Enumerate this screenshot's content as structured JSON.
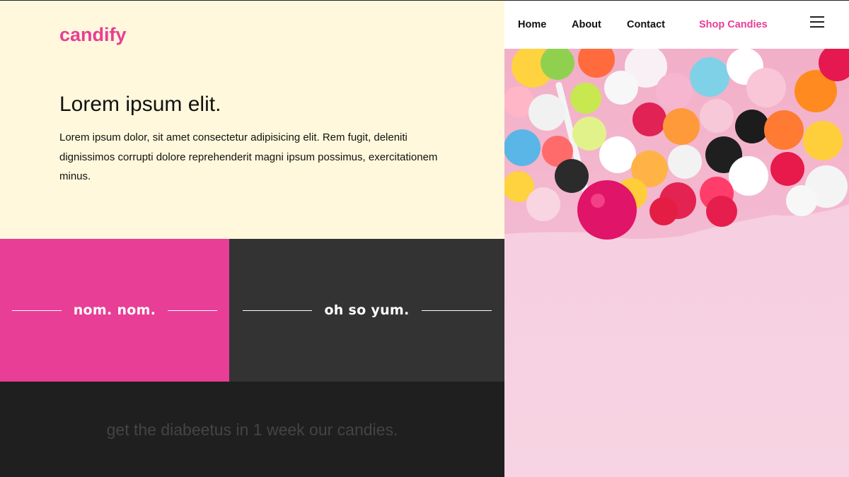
{
  "brand": {
    "name": "candify",
    "accent": "#e83e96"
  },
  "hero": {
    "headline": "Lorem ipsum elit.",
    "body": "Lorem ipsum dolor, sit amet consectetur adipisicing elit. Rem fugit, deleniti dignissimos corrupti dolore reprehenderit magni ipsum possimus, exercitationem minus."
  },
  "tiles": [
    {
      "label": "nom. nom.",
      "color": "#e83e96"
    },
    {
      "label": "oh so yum.",
      "color": "#333333"
    }
  ],
  "tagline": "get the diabeetus in 1 week our candies.",
  "nav": {
    "items": [
      {
        "label": "Home"
      },
      {
        "label": "About"
      },
      {
        "label": "Contact"
      },
      {
        "label": "Shop Candies"
      }
    ],
    "menu_icon": "hamburger-menu-icon"
  },
  "image": {
    "subject": "candy-pile-photo"
  }
}
